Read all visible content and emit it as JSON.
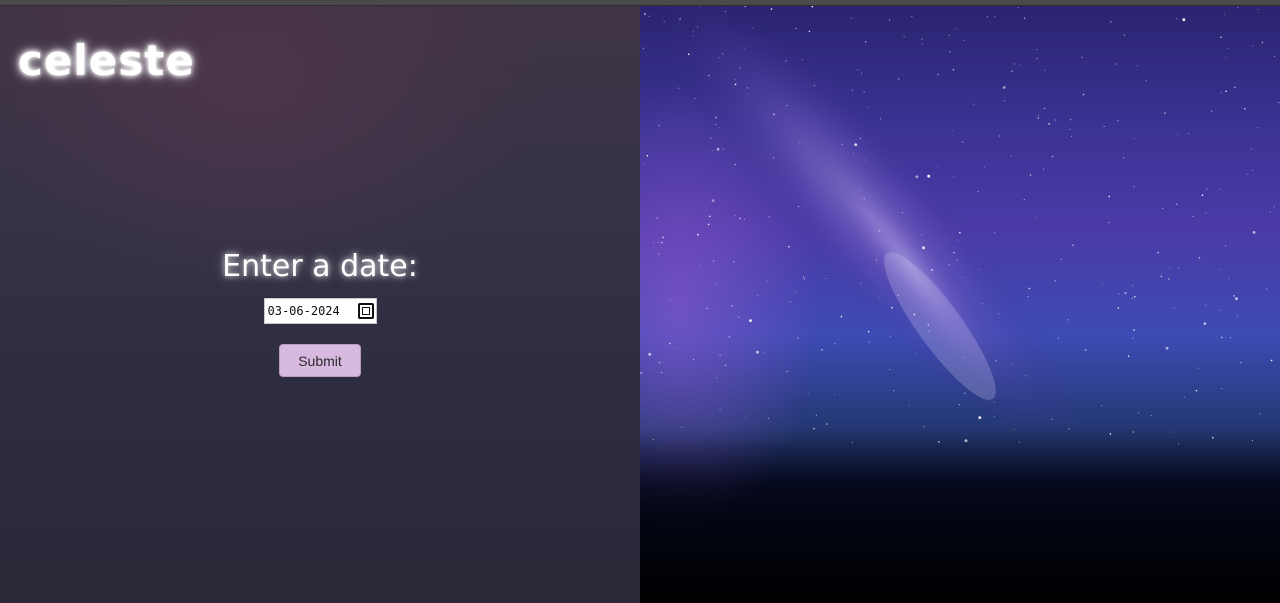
{
  "app": {
    "logo_text": "celeste"
  },
  "form": {
    "prompt_label": "Enter a date:",
    "date_value": "03-06-2024",
    "submit_label": "Submit"
  },
  "colors": {
    "button_bg": "#d8b9e0",
    "panel_left": "#353246",
    "sky_accent": "#4b3ba7"
  },
  "icons": {
    "date_picker": "calendar-icon"
  }
}
